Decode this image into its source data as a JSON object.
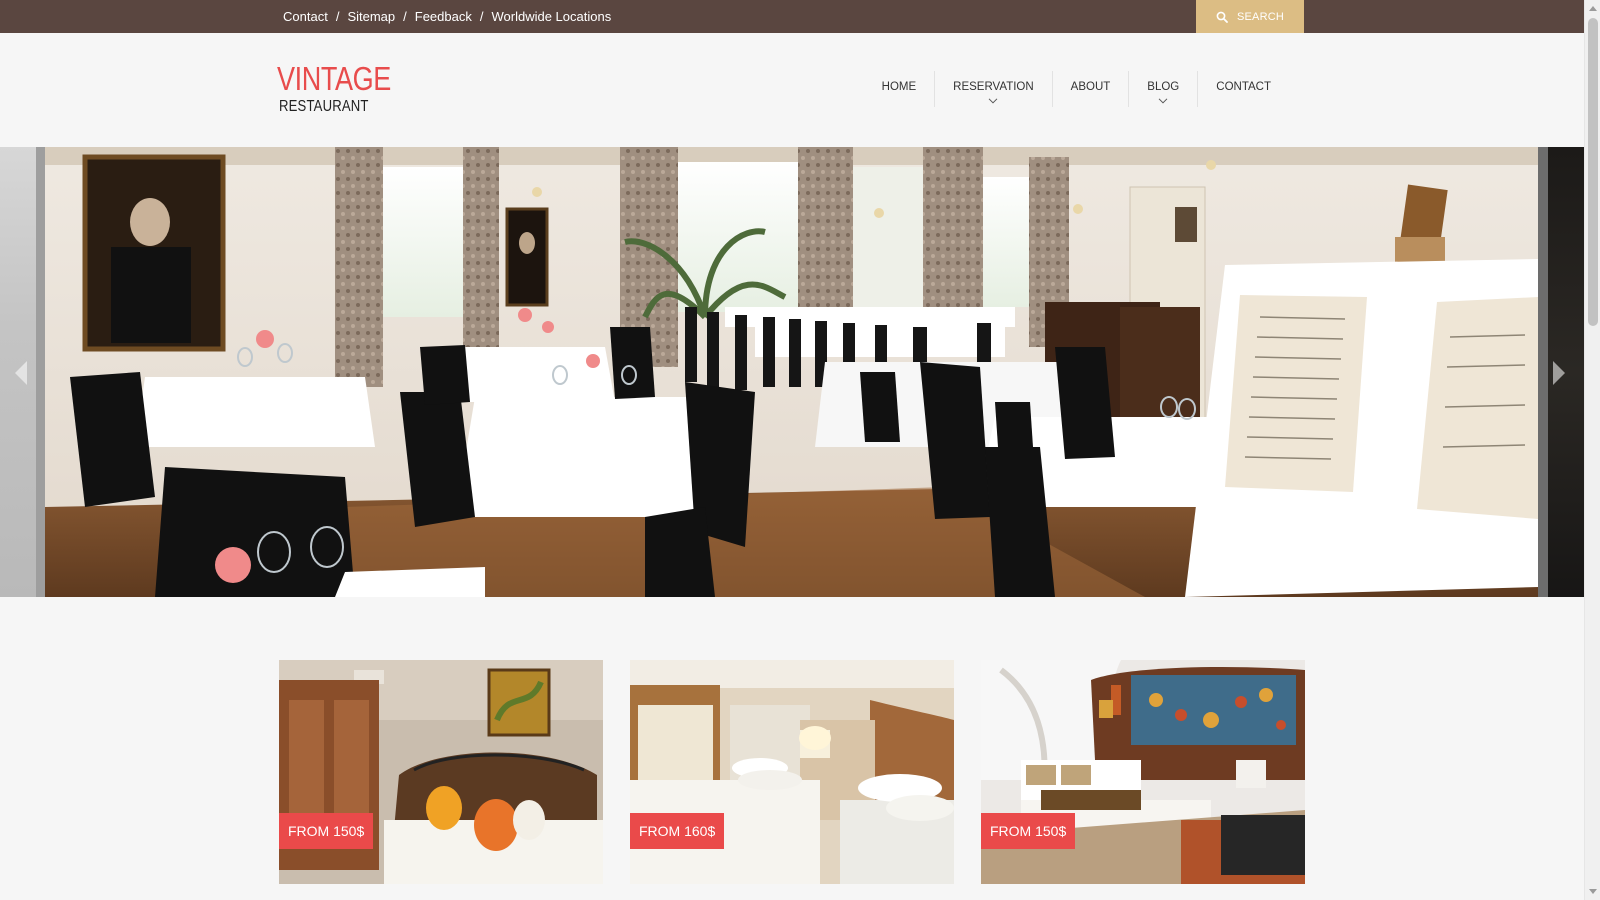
{
  "topbar": {
    "links": [
      "Contact",
      "Sitemap",
      "Feedback",
      "Worldwide Locations"
    ],
    "separator": "/",
    "search_label": "SEARCH",
    "colors": {
      "background": "#5a4640",
      "search": "#dcbd84"
    }
  },
  "logo": {
    "main": "VINTAGE",
    "sub": "RESTAURANT",
    "color": "#e84c4c"
  },
  "nav": {
    "items": [
      {
        "label": "HOME",
        "has_dropdown": false
      },
      {
        "label": "RESERVATION",
        "has_dropdown": true
      },
      {
        "label": "ABOUT",
        "has_dropdown": false
      },
      {
        "label": "BLOG",
        "has_dropdown": true
      },
      {
        "label": "CONTACT",
        "has_dropdown": false
      }
    ]
  },
  "hero": {
    "icons": {
      "prev": "chevron-left-icon",
      "next": "chevron-right-icon"
    }
  },
  "rooms": [
    {
      "price": "FROM 150$"
    },
    {
      "price": "FROM 160$"
    },
    {
      "price": "FROM 150$"
    }
  ],
  "accent_color": "#ea4a4a"
}
